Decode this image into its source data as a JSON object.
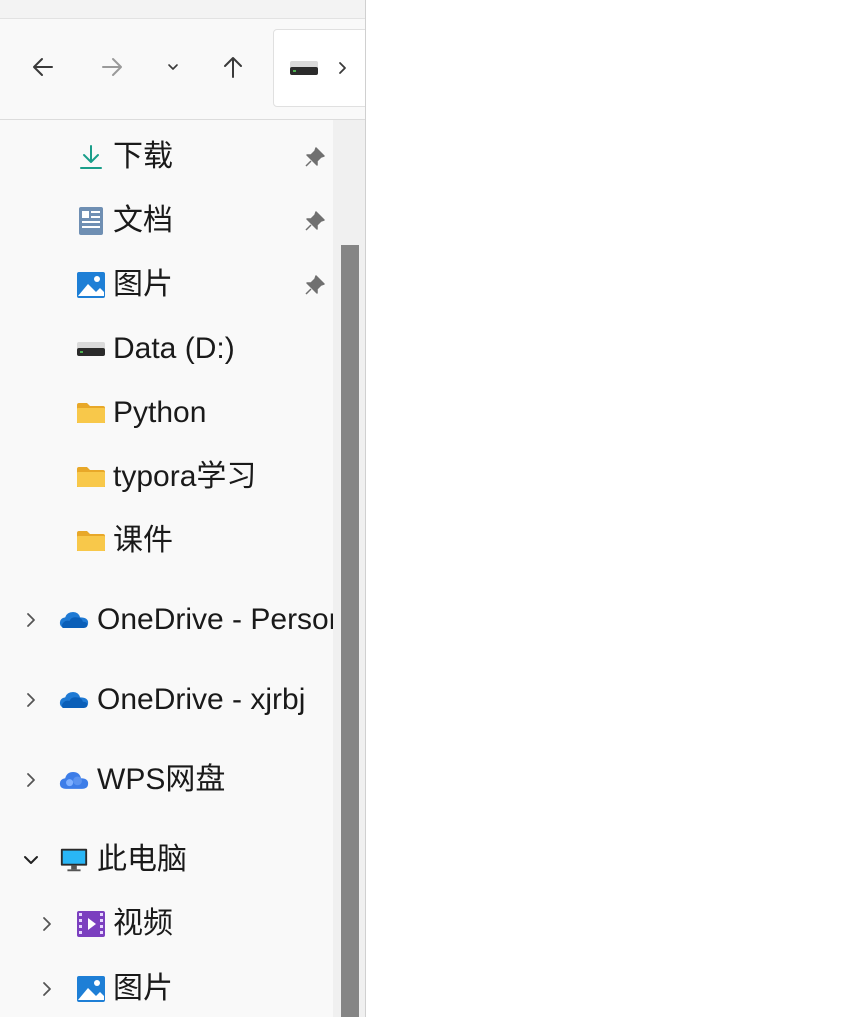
{
  "sidebar": {
    "quick_access": [
      {
        "label": "下载",
        "icon": "download-icon",
        "pinned": true
      },
      {
        "label": "文档",
        "icon": "documents-icon",
        "pinned": true
      },
      {
        "label": "图片",
        "icon": "pictures-icon",
        "pinned": true
      },
      {
        "label": "Data (D:)",
        "icon": "drive-icon",
        "pinned": false
      },
      {
        "label": "Python",
        "icon": "folder-icon",
        "pinned": false
      },
      {
        "label": "typora学习",
        "icon": "folder-icon",
        "pinned": false
      },
      {
        "label": "课件",
        "icon": "folder-icon",
        "pinned": false
      }
    ],
    "locations": [
      {
        "label": "OneDrive - Personal",
        "icon": "onedrive-icon",
        "expanded": false
      },
      {
        "label": "OneDrive - xjrbj",
        "icon": "onedrive-icon",
        "expanded": false
      },
      {
        "label": "WPS网盘",
        "icon": "wps-cloud-icon",
        "expanded": false
      },
      {
        "label": "此电脑",
        "icon": "this-pc-icon",
        "expanded": true
      }
    ],
    "this_pc_children": [
      {
        "label": "视频",
        "icon": "videos-icon"
      },
      {
        "label": "图片",
        "icon": "pictures-icon"
      }
    ]
  },
  "toolbar": {
    "back": "back-arrow-icon",
    "forward": "forward-arrow-icon",
    "recent": "chevron-down-icon",
    "up": "up-arrow-icon"
  },
  "colors": {
    "accent": "#0067c0",
    "folder": "#f8c84a",
    "scrollbar": "#858585"
  }
}
